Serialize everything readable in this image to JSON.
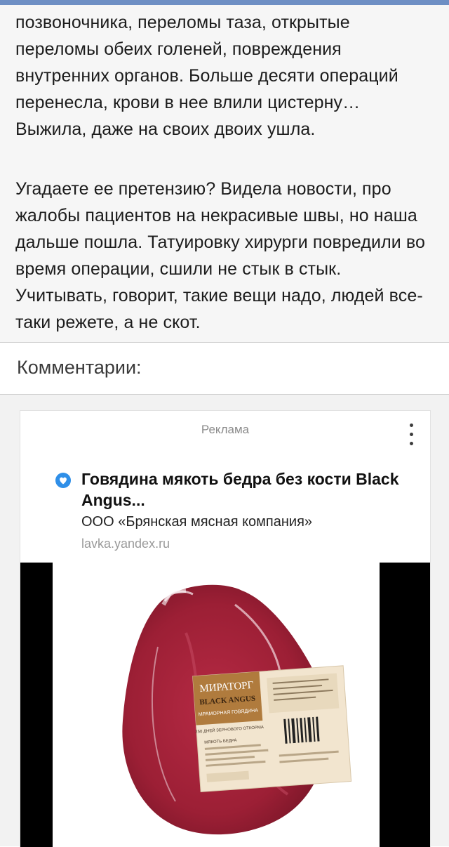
{
  "article": {
    "paragraph_1": "позвоночника, переломы таза, открытые переломы обеих голеней, повреждения внутренних органов. Больше десяти операций перенесла, крови в нее влили цистерну… Выжила, даже на своих двоих ушла.",
    "paragraph_2": "Угадаете ее претензию? Видела новости, про жалобы пациентов на некрасивые швы, но наша дальше пошла. Татуировку хирурги повредили во время операции, сшили не стык в стык. Учитывать, говорит, такие вещи надо, людей все-таки режете, а не скот."
  },
  "comments": {
    "title": "Комментарии:"
  },
  "ad": {
    "label": "Реклама",
    "title": "Говядина мякоть бедра без кости Black Angus...",
    "company": "ООО «Брянская мясная компания»",
    "domain": "lavka.yandex.ru",
    "image_alt": "beef-package-photo",
    "label_brand": "МИРАТОРГ",
    "label_line": "BLACK ANGUS",
    "label_sub": "МРАМОРНАЯ ГОВЯДИНА",
    "label_days": "250 ДНЕЙ ЗЕРНОВОГО ОТКОРМА",
    "label_cut": "МЯКОТЬ БЕДРА"
  },
  "colors": {
    "top_strip": "#6e8fc4",
    "article_bg": "#f6f6f6",
    "text": "#1c1c1c",
    "verified": "#2f8fe8",
    "meat": "#9c1f35"
  },
  "icons": [
    "verified-icon",
    "more-vertical-icon"
  ]
}
